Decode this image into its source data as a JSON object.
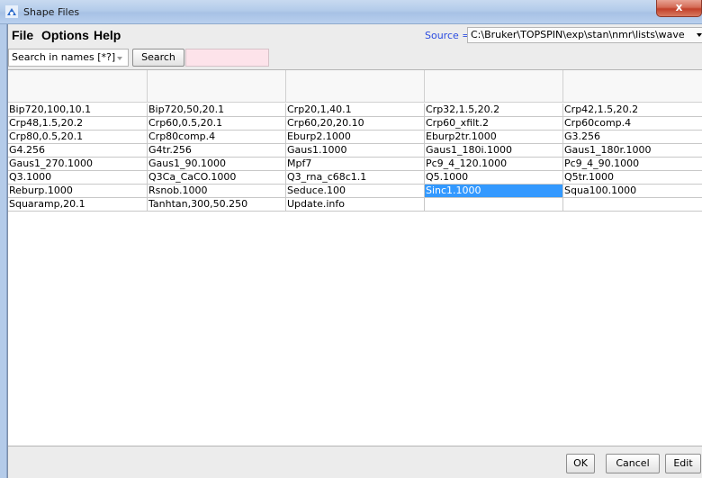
{
  "window": {
    "title": "Shape Files",
    "close_label": "x",
    "icon": "topspin-icon"
  },
  "menu": {
    "items": [
      "File",
      "Options",
      "Help"
    ]
  },
  "source": {
    "label": "Source =",
    "value": "C:\\Bruker\\TOPSPIN\\exp\\stan\\nmr\\lists\\wave"
  },
  "search": {
    "filter_value": "Search in names [*?]",
    "button_label": "Search",
    "input_value": ""
  },
  "table": {
    "rows": [
      [
        "Bip720,100,10.1",
        "Bip720,50,20.1",
        "Crp20,1,40.1",
        "Crp32,1.5,20.2",
        "Crp42,1.5,20.2"
      ],
      [
        "Crp48,1.5,20.2",
        "Crp60,0.5,20.1",
        "Crp60,20,20.10",
        "Crp60_xfilt.2",
        "Crp60comp.4"
      ],
      [
        "Crp80,0.5,20.1",
        "Crp80comp.4",
        "Eburp2.1000",
        "Eburp2tr.1000",
        "G3.256"
      ],
      [
        "G4.256",
        "G4tr.256",
        "Gaus1.1000",
        "Gaus1_180i.1000",
        "Gaus1_180r.1000"
      ],
      [
        "Gaus1_270.1000",
        "Gaus1_90.1000",
        "Mpf7",
        "Pc9_4_120.1000",
        "Pc9_4_90.1000"
      ],
      [
        "Q3.1000",
        "Q3Ca_CaCO.1000",
        "Q3_rna_c68c1.1",
        "Q5.1000",
        "Q5tr.1000"
      ],
      [
        "Reburp.1000",
        "Rsnob.1000",
        "Seduce.100",
        "Sinc1.1000",
        "Squa100.1000"
      ],
      [
        "Squaramp,20.1",
        "Tanhtan,300,50.250",
        "Update.info",
        "",
        ""
      ]
    ],
    "selected": "Sinc1.1000"
  },
  "buttons": {
    "ok": "OK",
    "cancel": "Cancel",
    "edit": "Edit"
  }
}
